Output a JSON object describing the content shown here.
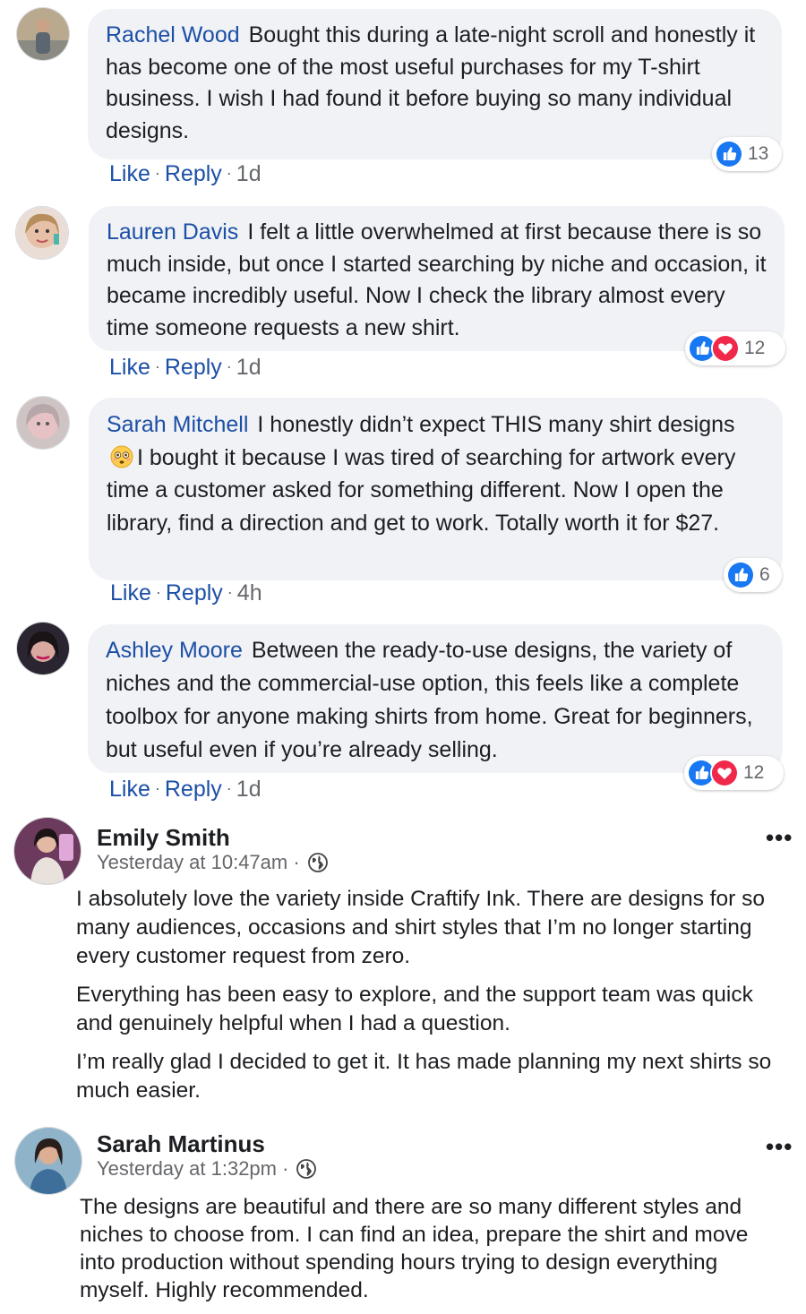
{
  "comments": [
    {
      "name": "Rachel Wood",
      "text": "Bought this during a late-night scroll and honestly it has become one of the most useful purchases for my T-shirt business. I wish I had found it before buying so many individual designs.",
      "actions": {
        "like": "Like",
        "reply": "Reply",
        "time": "1d"
      },
      "reactions": {
        "count": "13",
        "types": [
          "like"
        ]
      }
    },
    {
      "name": "Lauren Davis",
      "text": "I felt a little overwhelmed at first because there is so much inside, but once I started searching by niche and occasion, it became incredibly useful. Now I check the library almost every time someone requests a new shirt.",
      "actions": {
        "like": "Like",
        "reply": "Reply",
        "time": "1d"
      },
      "reactions": {
        "count": "12",
        "types": [
          "like",
          "love"
        ]
      }
    },
    {
      "name": "Sarah Mitchell",
      "text_before_emoji": "I honestly didn’t expect THIS many shirt designs",
      "emoji": "flushed-face",
      "text_after_emoji": "I bought it because I was tired of searching for artwork every time a customer asked for something different. Now I open the library, find a direction and get to work. Totally worth it for $27.",
      "actions": {
        "like": "Like",
        "reply": "Reply",
        "time": "4h"
      },
      "reactions": {
        "count": "6",
        "types": [
          "like"
        ]
      }
    },
    {
      "name": "Ashley Moore",
      "text": "Between the ready-to-use designs, the variety of niches and the commercial-use option, this feels like a complete toolbox for anyone making shirts from home. Great for beginners, but useful even if you’re already selling.",
      "actions": {
        "like": "Like",
        "reply": "Reply",
        "time": "1d"
      },
      "reactions": {
        "count": "12",
        "types": [
          "like",
          "love"
        ]
      }
    }
  ],
  "posts": [
    {
      "name": "Emily Smith",
      "meta": "Yesterday at 10:47am ·",
      "privacy_icon": "globe-icon",
      "more": "•••",
      "paragraphs": [
        "I absolutely love the variety inside Craftify Ink. There are designs for so many audiences, occasions and shirt styles that I’m no longer starting every customer request from zero.",
        "Everything has been easy to explore, and the support team was quick and genuinely helpful when I had a question.",
        "I’m really glad I decided to get it. It has made planning my next shirts so much easier."
      ]
    },
    {
      "name": "Sarah Martinus",
      "meta": "Yesterday at 1:32pm ·",
      "privacy_icon": "globe-icon",
      "more": "•••",
      "paragraphs": [
        "The designs are beautiful and there are so many different styles and niches to choose from. I can find an idea, prepare the shirt and move into production without spending hours trying to design everything myself. Highly recommended."
      ]
    }
  ],
  "colors": {
    "name_link": "#1c4fa6",
    "bubble_bg": "#f0f2f5",
    "meta_gray": "#65676b",
    "like_blue": "#1877f2",
    "love_red": "#f0284a"
  }
}
